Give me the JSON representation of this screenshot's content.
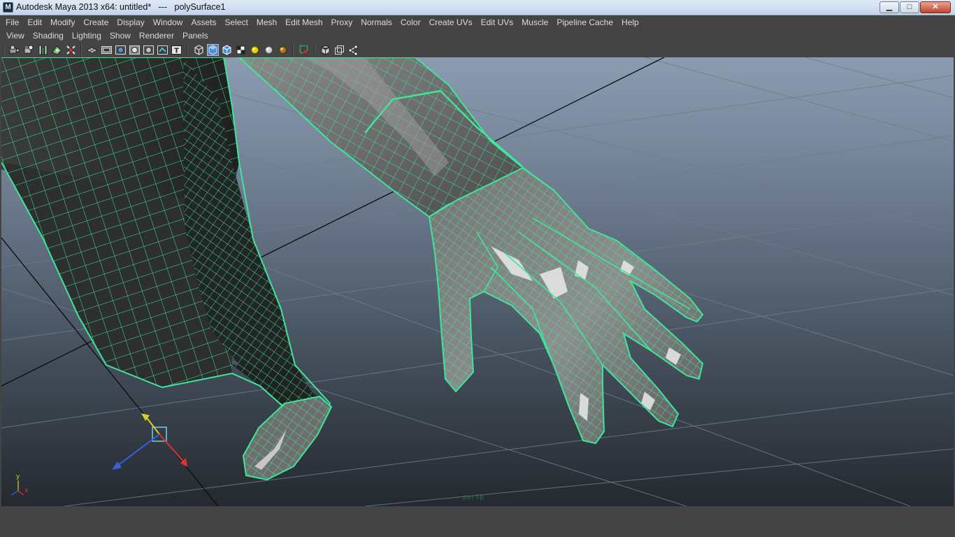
{
  "window": {
    "title": "Autodesk Maya 2013 x64: untitled*   ---   polySurface1",
    "icon": "maya-app-icon",
    "minimize_glyph": "▁",
    "maximize_glyph": "□",
    "close_glyph": "✕"
  },
  "main_menu": [
    "File",
    "Edit",
    "Modify",
    "Create",
    "Display",
    "Window",
    "Assets",
    "Select",
    "Mesh",
    "Edit Mesh",
    "Proxy",
    "Normals",
    "Color",
    "Create UVs",
    "Edit UVs",
    "Muscle",
    "Pipeline Cache",
    "Help"
  ],
  "panel_menu": [
    "View",
    "Shading",
    "Lighting",
    "Show",
    "Renderer",
    "Panels"
  ],
  "panel_toolbar_icons": [
    "select-camera-icon",
    "camera-attributes-icon",
    "bookmark-icon",
    "image-plane-icon",
    "2d-pan-zoom-icon",
    "grid-toggle-icon",
    "film-gate-icon",
    "resolution-gate-icon",
    "gate-mask-icon",
    "field-chart-icon",
    "safe-action-icon",
    "wireframe-icon",
    "smooth-shade-icon",
    "wireframe-on-shaded-icon",
    "textured-icon",
    "use-default-lights-icon",
    "shadows-icon",
    "xray-icon",
    "isolate-select-icon",
    "xray-joints-icon",
    "xray-active-icon",
    "high-quality-icon"
  ],
  "viewport": {
    "camera_name": "persp",
    "wire_color": "#3fe69a",
    "axis": {
      "x": "x",
      "y": "y",
      "x_color": "#e33030",
      "y_color": "#d8cf2a",
      "z_color": "#3b5fd6"
    }
  }
}
